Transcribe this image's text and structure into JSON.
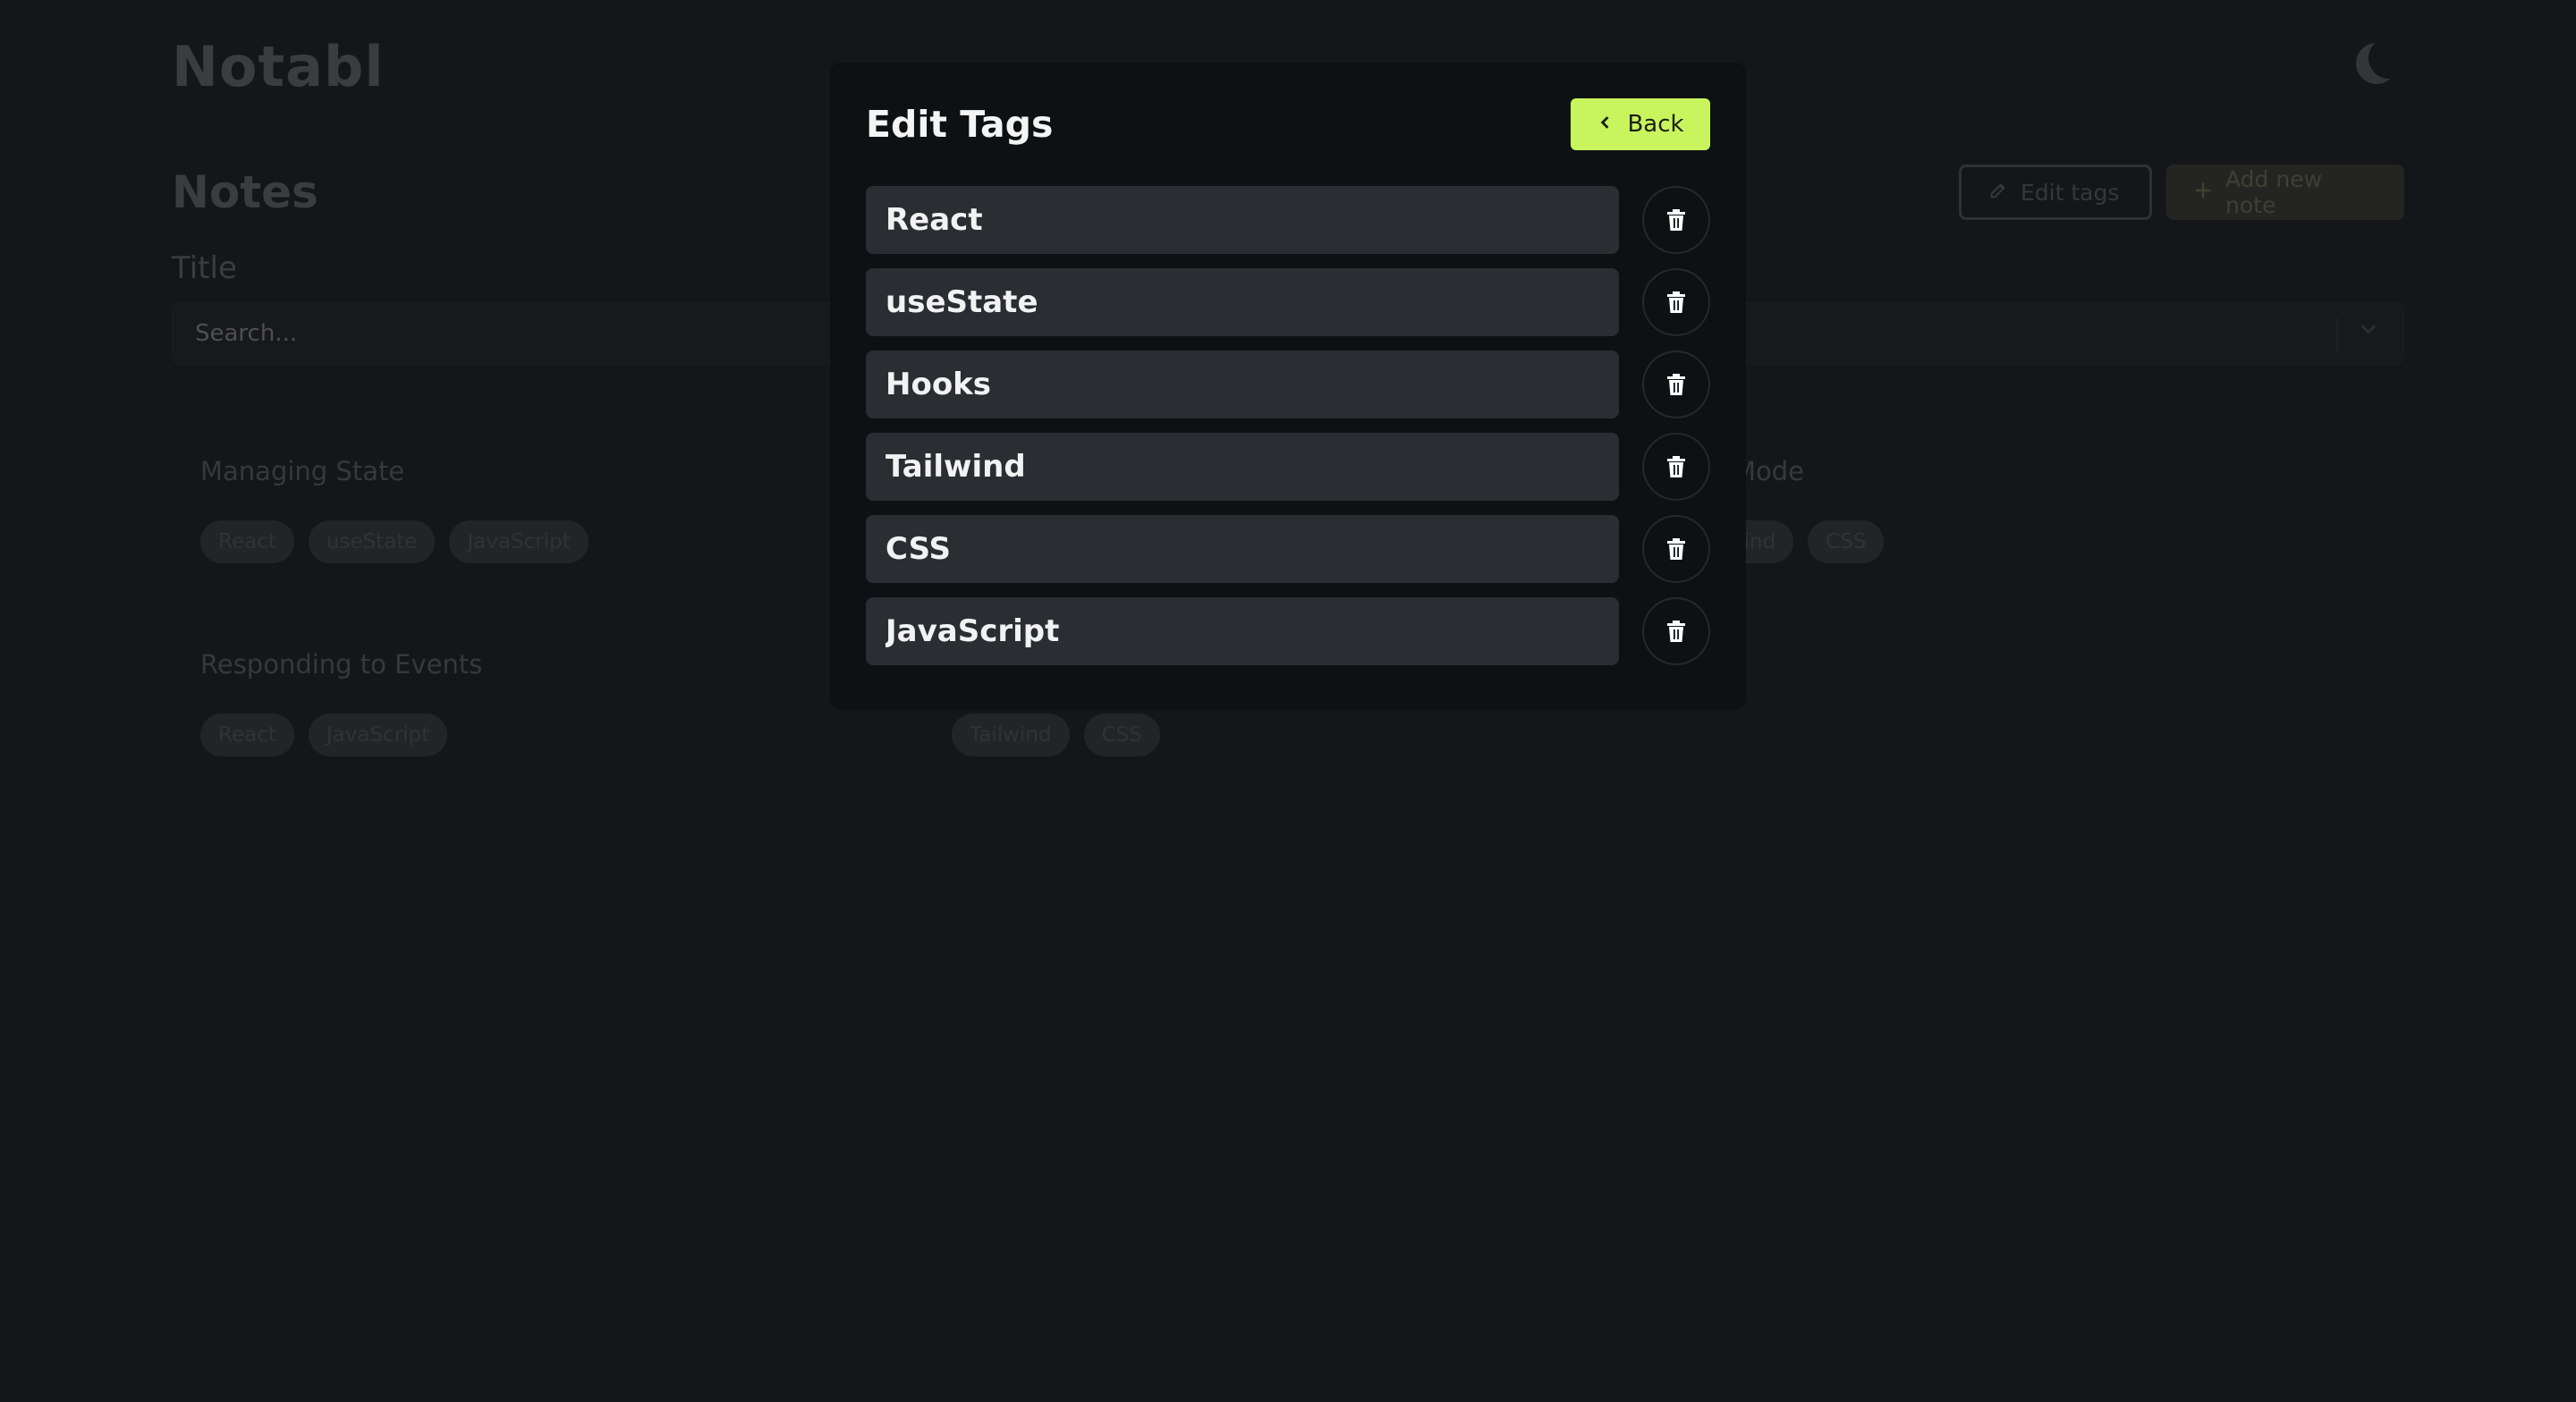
{
  "app": {
    "logo": "Notabl",
    "page_title": "Notes",
    "edit_tags_label": "Edit tags",
    "add_note_label": "Add new note",
    "title_label": "Title",
    "search_placeholder": "Search..."
  },
  "notes": [
    {
      "title": "Managing State",
      "tags": [
        "React",
        "useState",
        "JavaScript"
      ]
    },
    {
      "title": "k Mode",
      "tags": [
        "ilwind",
        "CSS"
      ]
    },
    {
      "title": "Responding to Events",
      "tags": [
        "React",
        "JavaScript"
      ]
    },
    {
      "title": "",
      "tags": [
        "Tailwind",
        "CSS"
      ]
    }
  ],
  "modal": {
    "title": "Edit Tags",
    "back_label": "Back",
    "tags": [
      "React",
      "useState",
      "Hooks",
      "Tailwind",
      "CSS",
      "JavaScript"
    ]
  },
  "icons": {
    "back": "chevron-left-icon",
    "delete": "trash-icon",
    "theme": "moon-icon",
    "edit": "pencil-icon",
    "add": "plus-icon",
    "dropdown": "chevron-down-icon"
  },
  "colors": {
    "background": "#1b1e21",
    "modal_background": "#0e1113",
    "accent": "#c8f55e",
    "tag_input_background": "#2a2d31"
  }
}
